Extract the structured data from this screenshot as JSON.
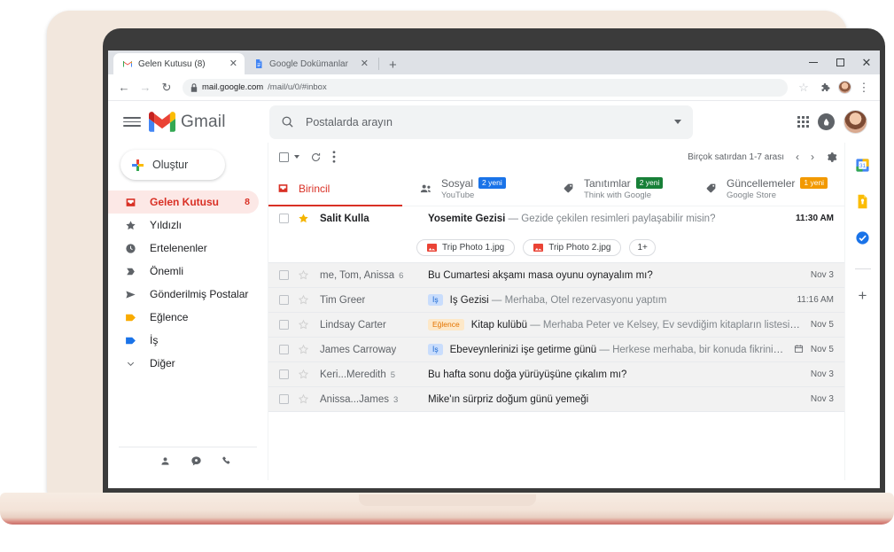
{
  "browser": {
    "tabs": [
      {
        "title": "Gelen Kutusu (8)",
        "favicon": "gmail-icon",
        "active": true,
        "close_label": "✕"
      },
      {
        "title": "Google Dokümanlar",
        "favicon": "docs-icon",
        "active": false,
        "close_label": "✕"
      }
    ],
    "new_tab_label": "+",
    "back_label": "←",
    "forward_label": "→",
    "reload_label": "↻",
    "lock_label": "🔒",
    "url_domain": "mail.google.com",
    "url_path": "/mail/u/0/#inbox",
    "star_label": "☆",
    "extensions_label": "puzzle-icon",
    "menu_label": "⋮",
    "window_minimize": "minimize",
    "window_maximize": "maximize",
    "window_close": "✕"
  },
  "gmail": {
    "menu_label": "hamburger-icon",
    "logo_text": "Gmail",
    "search": {
      "placeholder": "Postalarda arayın",
      "icon": "search-icon",
      "options_icon": "chevron-down-icon"
    },
    "header_right": {
      "apps_icon": "apps-grid-icon",
      "support_icon": "drop-icon",
      "avatar": "user-avatar"
    },
    "compose": {
      "label": "Oluştur",
      "icon": "plus-icon"
    },
    "sidebar": {
      "items": [
        {
          "label": "Gelen Kutusu",
          "icon": "inbox-icon",
          "count": "8",
          "active": true
        },
        {
          "label": "Yıldızlı",
          "icon": "star-icon",
          "count": "",
          "active": false
        },
        {
          "label": "Ertelenenler",
          "icon": "clock-icon",
          "count": "",
          "active": false
        },
        {
          "label": "Önemli",
          "icon": "important-icon",
          "count": "",
          "active": false
        },
        {
          "label": "Gönderilmiş Postalar",
          "icon": "send-icon",
          "count": "",
          "active": false
        },
        {
          "label": "Eğlence",
          "icon": "label-yellow-icon",
          "count": "",
          "active": false
        },
        {
          "label": "İş",
          "icon": "label-blue-icon",
          "count": "",
          "active": false
        },
        {
          "label": "Diğer",
          "icon": "chevron-down-icon",
          "count": "",
          "active": false
        }
      ],
      "footer_icons": [
        "contacts-icon",
        "chat-icon",
        "meet-icon"
      ]
    },
    "toolbar": {
      "select_all_icon": "checkbox-icon",
      "select_caret_icon": "chevron-down-icon",
      "refresh_icon": "refresh-icon",
      "more_icon": "more-vertical-icon",
      "range_text": "Birçok satırdan 1-7 arası",
      "prev_icon": "‹",
      "next_icon": "›",
      "settings_icon": "gear-icon"
    },
    "category_tabs": [
      {
        "name": "Birincil",
        "sub": "",
        "badge": "",
        "badge_color": "",
        "icon": "inbox-icon",
        "active": true
      },
      {
        "name": "Sosyal",
        "sub": "YouTube",
        "badge": "2 yeni",
        "badge_color": "#1a73e8",
        "icon": "people-icon",
        "active": false
      },
      {
        "name": "Tanıtımlar",
        "sub": "Think with Google",
        "badge": "2 yeni",
        "badge_color": "#188038",
        "icon": "tag-icon",
        "active": false
      },
      {
        "name": "Güncellemeler",
        "sub": "Google Store",
        "badge": "1 yeni",
        "badge_color": "#f29900",
        "icon": "tag-icon",
        "active": false
      }
    ],
    "emails": [
      {
        "sender": "Salit Kulla",
        "count": "",
        "starred": true,
        "unread": true,
        "label": "",
        "label_bg": "",
        "label_color": "",
        "subject": "Yosemite Gezisi",
        "separator": " — ",
        "snippet": "Gezide çekilen resimleri paylaşabilir misin?",
        "time": "11:30 AM",
        "has_calendar": false,
        "attachments": [
          {
            "name": "Trip Photo 1.jpg",
            "icon": "image-icon"
          },
          {
            "name": "Trip Photo 2.jpg",
            "icon": "image-icon"
          },
          {
            "name": "1+",
            "icon": ""
          }
        ]
      },
      {
        "sender": "me, Tom, Anissa",
        "count": "6",
        "starred": false,
        "unread": false,
        "label": "",
        "label_bg": "",
        "label_color": "",
        "subject": "Bu Cumartesi akşamı masa oyunu oynayalım mı?",
        "separator": "",
        "snippet": "",
        "time": "Nov 3",
        "has_calendar": false,
        "attachments": []
      },
      {
        "sender": "Tim Greer",
        "count": "",
        "starred": false,
        "unread": false,
        "label": "İş",
        "label_bg": "#c9ddfc",
        "label_color": "#1967d2",
        "subject": "İş Gezisi",
        "separator": " — ",
        "snippet": "Merhaba, Otel rezervasyonu yaptım",
        "time": "11:16 AM",
        "has_calendar": false,
        "attachments": []
      },
      {
        "sender": "Lindsay Carter",
        "count": "",
        "starred": false,
        "unread": false,
        "label": "Eğlence",
        "label_bg": "#fde8c8",
        "label_color": "#e37400",
        "subject": "Kitap kulübü",
        "separator": " — ",
        "snippet": "Merhaba Peter ve Kelsey, Ev sevdiğim kitapların listesini paylaşıyorum...",
        "time": "Nov 5",
        "has_calendar": false,
        "attachments": []
      },
      {
        "sender": "James Carroway",
        "count": "",
        "starred": false,
        "unread": false,
        "label": "İş",
        "label_bg": "#c9ddfc",
        "label_color": "#1967d2",
        "subject": "Ebeveynlerinizi işe getirme günü",
        "separator": " — ",
        "snippet": "Herkese merhaba, bir konuda fikrinizi alacaktım...",
        "time": "Nov 5",
        "has_calendar": true,
        "attachments": []
      },
      {
        "sender": "Keri...Meredith",
        "count": "5",
        "starred": false,
        "unread": false,
        "label": "",
        "label_bg": "",
        "label_color": "",
        "subject": "Bu hafta sonu doğa yürüyüşüne çıkalım mı?",
        "separator": "",
        "snippet": "",
        "time": "Nov 3",
        "has_calendar": false,
        "attachments": []
      },
      {
        "sender": "Anissa...James",
        "count": "3",
        "starred": false,
        "unread": false,
        "label": "",
        "label_bg": "",
        "label_color": "",
        "subject": "Mike'ın sürpriz doğum günü yemeği",
        "separator": "",
        "snippet": "",
        "time": "Nov 3",
        "has_calendar": false,
        "attachments": []
      }
    ],
    "side_panel": {
      "items": [
        "calendar-icon",
        "keep-icon",
        "tasks-icon"
      ],
      "add_label": "+"
    }
  },
  "colors": {
    "accent_red": "#d93025",
    "active_bg": "#fce8e6",
    "row_read_bg": "#f2f2f2",
    "blue": "#1a73e8",
    "green": "#188038",
    "orange": "#f29900"
  }
}
